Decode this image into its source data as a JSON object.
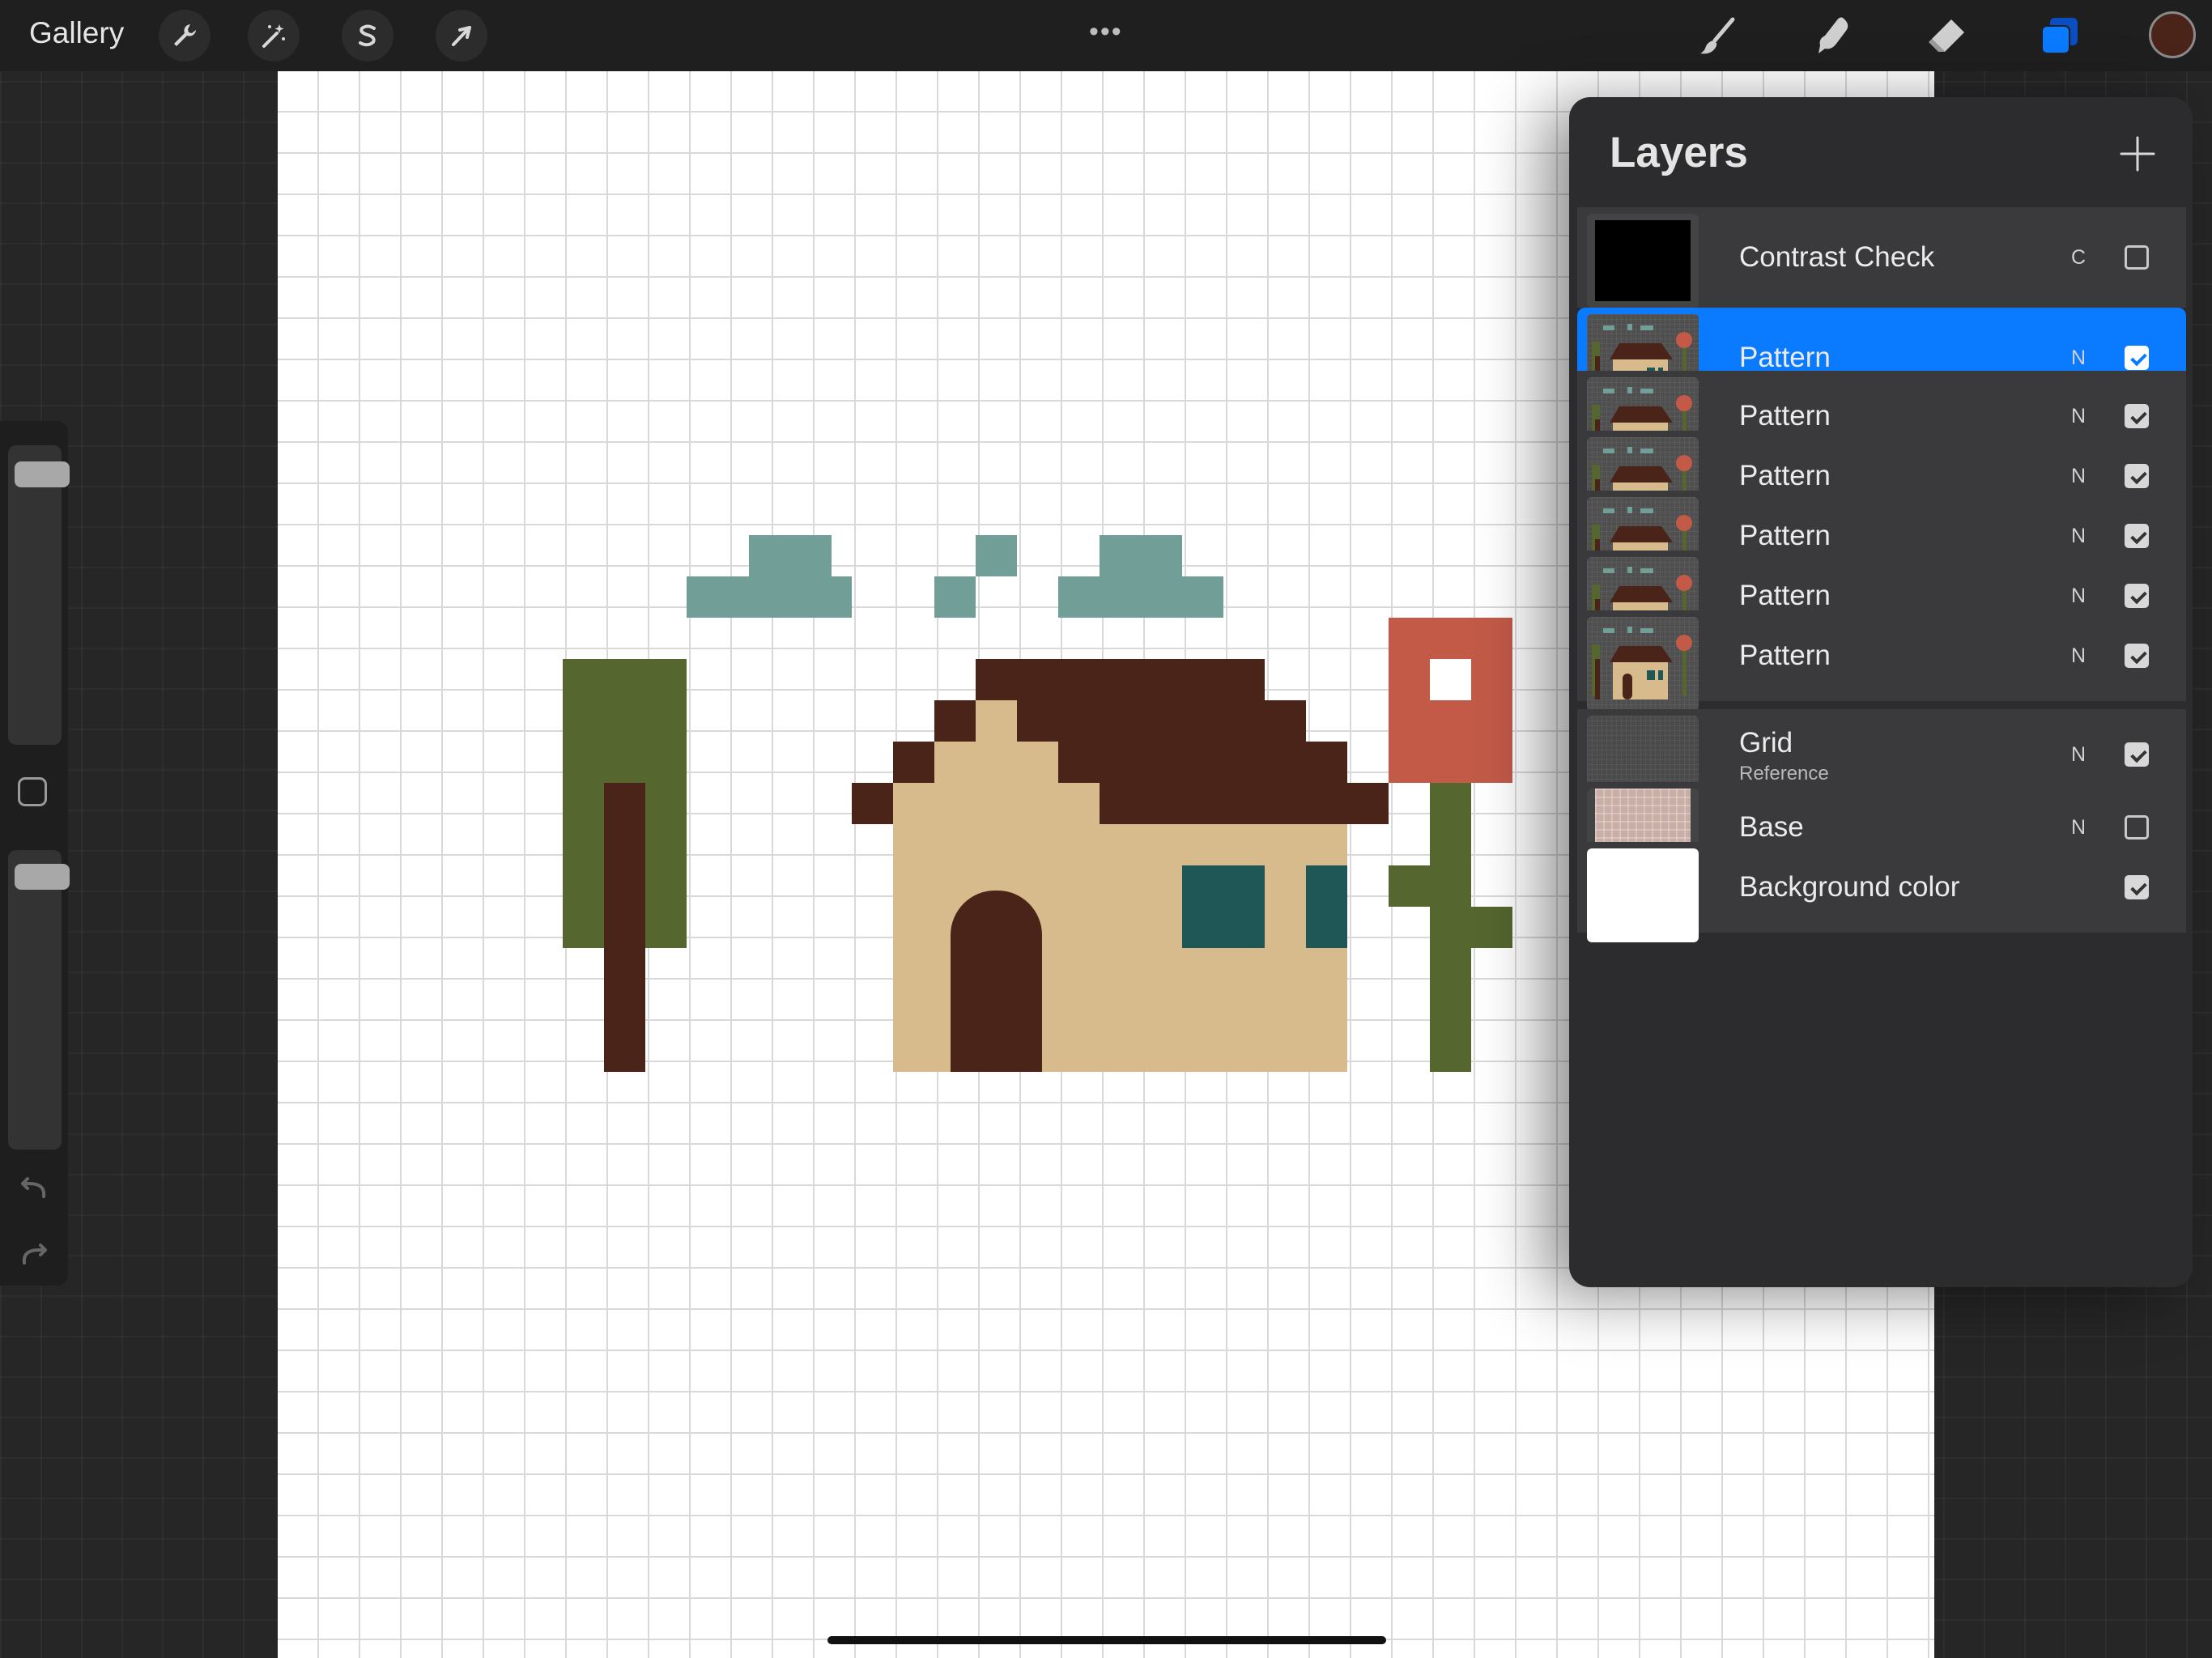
{
  "topbar": {
    "gallery_label": "Gallery",
    "left_tools": [
      "wrench-icon",
      "magic-wand-icon",
      "selection-s-icon",
      "transform-arrow-icon"
    ],
    "more_label": "•••",
    "right_tools": [
      "brush-icon",
      "smudge-icon",
      "eraser-icon",
      "layers-icon"
    ],
    "active_color": "#4a2419",
    "accent_color": "#0a7aff"
  },
  "sidebar": {
    "brush_size_level": 0.06,
    "opacity_level": 0.05,
    "icons": [
      "modify-square-icon",
      "undo-icon",
      "redo-icon"
    ]
  },
  "canvas": {
    "artwork": "pixel-house",
    "palette": {
      "cloud": "#729e98",
      "roof": "#4a2419",
      "wall": "#d8bb8c",
      "door": "#4a2419",
      "window": "#1f5656",
      "tree_top": "#56662f",
      "trunk": "#4a2419",
      "flower": "#c35a48",
      "stem": "#56662f"
    }
  },
  "layers": {
    "title": "Layers",
    "add_icon": "plus-icon",
    "items": [
      {
        "name": "Contrast Check",
        "sub": "",
        "blend": "C",
        "visible": false,
        "thumb": "black"
      },
      {
        "name": "Pattern",
        "sub": "",
        "blend": "N",
        "visible": true,
        "thumb": "house",
        "selected": true
      },
      {
        "name": "Pattern",
        "sub": "",
        "blend": "N",
        "visible": true,
        "thumb": "house"
      },
      {
        "name": "Pattern",
        "sub": "",
        "blend": "N",
        "visible": true,
        "thumb": "house"
      },
      {
        "name": "Pattern",
        "sub": "",
        "blend": "N",
        "visible": true,
        "thumb": "house"
      },
      {
        "name": "Pattern",
        "sub": "",
        "blend": "N",
        "visible": true,
        "thumb": "house"
      },
      {
        "name": "Pattern",
        "sub": "",
        "blend": "N",
        "visible": true,
        "thumb": "house"
      },
      {
        "name": "Grid",
        "sub": "Reference",
        "blend": "N",
        "visible": true,
        "thumb": "grid"
      },
      {
        "name": "Base",
        "sub": "",
        "blend": "N",
        "visible": false,
        "thumb": "fabric"
      },
      {
        "name": "Background color",
        "sub": "",
        "blend": "",
        "visible": true,
        "thumb": "white"
      }
    ]
  }
}
